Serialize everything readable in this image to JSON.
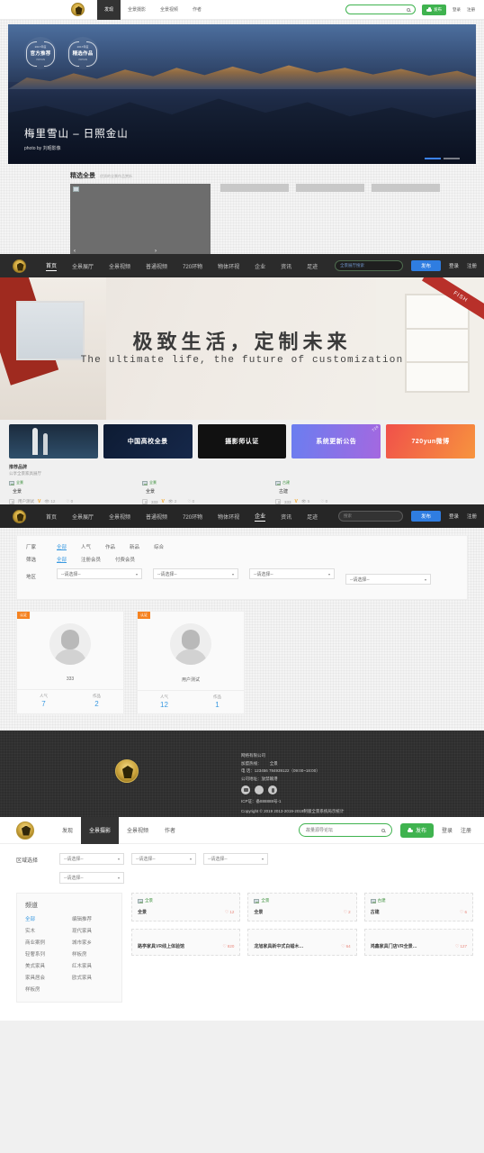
{
  "nav_top": {
    "items": [
      {
        "label": "发现",
        "active": true
      },
      {
        "label": "全景摄影",
        "active": false
      },
      {
        "label": "全景视频",
        "active": false
      },
      {
        "label": "作者",
        "active": false
      }
    ],
    "search_placeholder": "",
    "publish_label": "发布",
    "login_label": "登录",
    "register_label": "注册"
  },
  "hero": {
    "title": "梅里雪山 – 日照金山",
    "subtitle": "photo by 刘昭影像",
    "awards": [
      {
        "year": "2017年度",
        "title": "官方推荐",
        "sub": "720YUN"
      },
      {
        "year": "2017年度",
        "title": "精选作品",
        "sub": "720YUN"
      }
    ]
  },
  "featured": {
    "title": "精选全景",
    "subtitle": "优质的全景作品赏析",
    "prev": "‹",
    "next": "›"
  },
  "nav_dark": {
    "items": [
      {
        "label": "首页",
        "active": true
      },
      {
        "label": "全景展厅",
        "active": false
      },
      {
        "label": "全景视频",
        "active": false
      },
      {
        "label": "普通视频",
        "active": false
      },
      {
        "label": "720环物",
        "active": false
      },
      {
        "label": "物体环视",
        "active": false
      },
      {
        "label": "企业",
        "active": false
      },
      {
        "label": "资讯",
        "active": false
      },
      {
        "label": "足迹",
        "active": false
      }
    ],
    "search_value": "全景展厅搜索",
    "publish_label": "发布",
    "login_label": "登录",
    "register_label": "注册"
  },
  "banner": {
    "headline": "极致生活，定制未来",
    "subhead": "The ultimate life, the future of customization",
    "ribbon": "FISH"
  },
  "promos": [
    {
      "label": "",
      "style": "rocket"
    },
    {
      "label": "中国高校全景",
      "style": "dark-blue"
    },
    {
      "label": "摄影师认证",
      "style": "black"
    },
    {
      "label": "系统更新公告",
      "style": "purple",
      "corner": "720"
    },
    {
      "label": "720yun微博",
      "style": "orange"
    }
  ],
  "brand_section": {
    "title": "推荐品牌",
    "subtitle": "公享全景家具展厅",
    "items": [
      {
        "img_alt": "全景",
        "name": "全景",
        "author": "用户测试",
        "verified": "V",
        "views": "12",
        "likes": "0"
      },
      {
        "img_alt": "全景",
        "name": "全景",
        "author": "333",
        "verified": "V",
        "views": "2",
        "likes": "0"
      },
      {
        "img_alt": "古建",
        "name": "古建",
        "author": "333",
        "verified": "V",
        "views": "5",
        "likes": "0"
      }
    ]
  },
  "nav_enterprise": {
    "items": [
      {
        "label": "首页",
        "active": false
      },
      {
        "label": "全景展厅",
        "active": false
      },
      {
        "label": "全景视频",
        "active": false
      },
      {
        "label": "普通视频",
        "active": false
      },
      {
        "label": "720环物",
        "active": false
      },
      {
        "label": "物体环视",
        "active": false
      },
      {
        "label": "企业",
        "active": true
      },
      {
        "label": "资讯",
        "active": false
      },
      {
        "label": "足迹",
        "active": false
      }
    ],
    "search_placeholder": "搜索",
    "publish_label": "发布",
    "login_label": "登录",
    "register_label": "注册"
  },
  "filters": {
    "row1": {
      "label": "厂家",
      "options": [
        {
          "label": "全部",
          "on": true
        },
        {
          "label": "人气",
          "on": false
        },
        {
          "label": "作品",
          "on": false
        },
        {
          "label": "新品",
          "on": false
        },
        {
          "label": "综合",
          "on": false
        }
      ]
    },
    "row2": {
      "label": "筛选",
      "options": [
        {
          "label": "全部",
          "on": true
        },
        {
          "label": "注册会员",
          "on": false
        },
        {
          "label": "付费会员",
          "on": false
        }
      ]
    },
    "row3": {
      "label": "地区",
      "selects": [
        "--请选择--",
        "--请选择--",
        "--请选择--",
        "--请选择--"
      ]
    }
  },
  "user_cards": [
    {
      "badge": "认证",
      "name": "333",
      "stat1_label": "人气",
      "stat1_value": "7",
      "stat2_label": "作品",
      "stat2_value": "2"
    },
    {
      "badge": "认证",
      "name": "用户测试",
      "stat1_label": "人气",
      "stat1_value": "12",
      "stat2_label": "作品",
      "stat2_value": "1"
    }
  ],
  "footer": {
    "company": "网络有限公司",
    "hotline_label": "加盟热线：",
    "hotline_value": "全景",
    "phone": "电 话：123456 784939122（09:00~18:00）",
    "address": "公司地址：放禁输港",
    "icp": "ICP证：备888888号-1",
    "copyright": "Copyright © 2019 2013-2019-2019制版全景系统局示统计",
    "socials": [
      "weibo-icon",
      "wechat-icon",
      "qq-icon"
    ]
  },
  "nav_green": {
    "items": [
      {
        "label": "发现",
        "active": false
      },
      {
        "label": "全景摄影",
        "active": true
      },
      {
        "label": "全景视频",
        "active": false
      },
      {
        "label": "作者",
        "active": false
      }
    ],
    "search_value": "故量源导论坛",
    "publish_label": "发布",
    "login_label": "登录",
    "register_label": "注册"
  },
  "region": {
    "label": "区域选择",
    "selects": [
      "--请选择--",
      "--请选择--",
      "--请选择--",
      "--请选择--"
    ]
  },
  "channel": {
    "title": "频道",
    "items": [
      {
        "label": "全部",
        "on": true
      },
      {
        "label": "编辑推荐",
        "on": false
      },
      {
        "label": "实木",
        "on": false
      },
      {
        "label": "现代家具",
        "on": false
      },
      {
        "label": "商业案例",
        "on": false
      },
      {
        "label": "城市家乡",
        "on": false
      },
      {
        "label": "轻奢系列",
        "on": false
      },
      {
        "label": "样板房",
        "on": false
      },
      {
        "label": "美式家具",
        "on": false
      },
      {
        "label": "红木家具",
        "on": false
      },
      {
        "label": "家具居会",
        "on": false
      },
      {
        "label": "欧式家具",
        "on": false
      },
      {
        "label": "样板房",
        "on": false
      }
    ]
  },
  "gallery": [
    {
      "img_alt": "全景",
      "name": "全景",
      "likes": "12"
    },
    {
      "img_alt": "全景",
      "name": "全景",
      "likes": "2"
    },
    {
      "img_alt": "古建",
      "name": "古建",
      "likes": "6"
    },
    {
      "img_alt": "",
      "name": "路亭家具VR线上体验馆",
      "likes": "820"
    },
    {
      "img_alt": "",
      "name": "龙旭家具新中式白蜡木…",
      "likes": "64"
    },
    {
      "img_alt": "",
      "name": "鸿鑫家具门店VR全景…",
      "likes": "127"
    }
  ],
  "colors": {
    "green": "#3fb34f",
    "blue": "#2f7de1",
    "link_blue": "#3b9ae1",
    "orange": "#f58220",
    "heart": "#e8857a"
  }
}
